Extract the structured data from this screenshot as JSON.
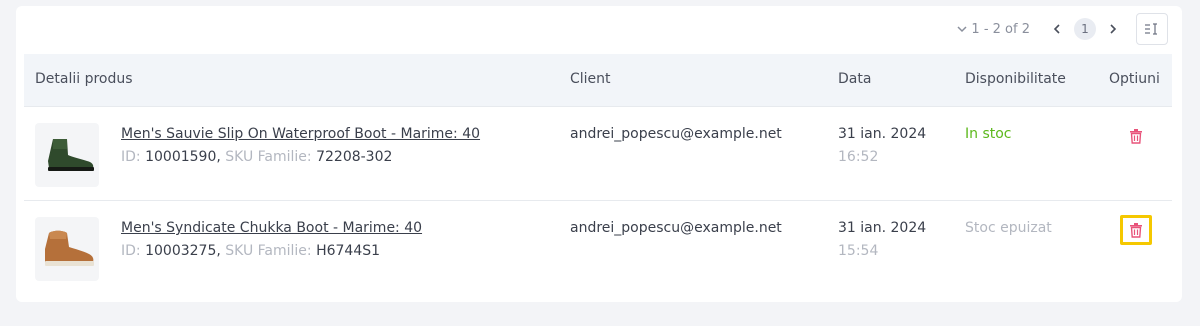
{
  "pagination": {
    "range": "1 - 2 of 2",
    "current_page": "1"
  },
  "table": {
    "headers": {
      "product": "Detalii produs",
      "client": "Client",
      "date": "Data",
      "availability": "Disponibilitate",
      "options": "Optiuni"
    },
    "rows": [
      {
        "name": "Men's Sauvie Slip On Waterproof Boot - Marime: 40",
        "id_label": "ID:",
        "id": "10001590,",
        "sku_label": "SKU Familie:",
        "sku": "72208-302",
        "client": "andrei_popescu@example.net",
        "date": "31 ian. 2024",
        "time": "16:52",
        "availability": "In stoc",
        "thumbnail_icon": "green-boot-image"
      },
      {
        "name": "Men's Syndicate Chukka Boot - Marime: 40",
        "id_label": "ID:",
        "id": "10003275,",
        "sku_label": "SKU Familie:",
        "sku": "H6744S1",
        "client": "andrei_popescu@example.net",
        "date": "31 ian. 2024",
        "time": "15:54",
        "availability": "Stoc epuizat",
        "thumbnail_icon": "brown-boot-image"
      }
    ]
  },
  "colors": {
    "in_stock": "#5cb81c",
    "muted": "#b3b7c0",
    "delete": "#e8537a",
    "highlight": "#f5c800"
  }
}
